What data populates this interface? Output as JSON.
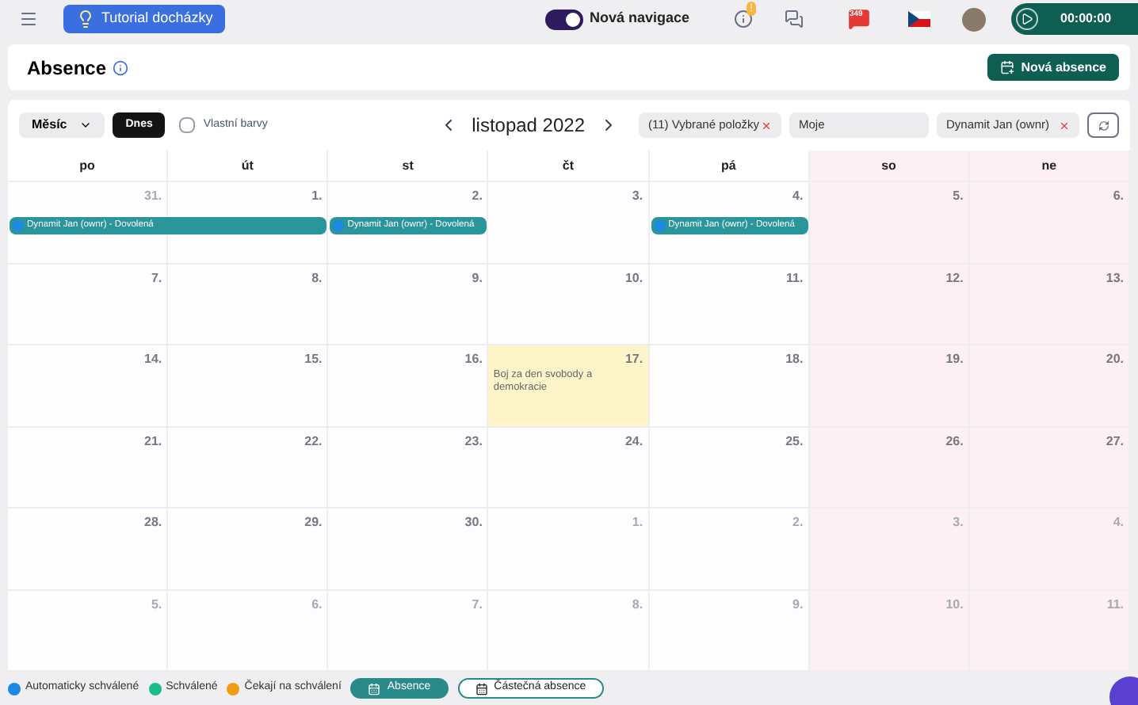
{
  "topbar": {
    "tutorial": "Tutorial docházky",
    "nav_toggle": {
      "label": "Nová navigace",
      "on": true
    },
    "alerts_badge": "!",
    "notifications_badge": "349",
    "timer": "00:00:00"
  },
  "header": {
    "title": "Absence",
    "new_button": "Nová absence"
  },
  "toolbar": {
    "view": "Měsíc",
    "today": "Dnes",
    "custom_colors": {
      "label": "Vlastní barvy",
      "checked": false
    },
    "month": "listopad 2022",
    "filters": [
      {
        "text": "(11) Vybrané položky",
        "clearable": true
      },
      {
        "text": "Moje",
        "clearable": false
      },
      {
        "text": "Dynamit Jan (ownr)",
        "clearable": true
      }
    ]
  },
  "columns": [
    {
      "label": "po",
      "weekend": false
    },
    {
      "label": "út",
      "weekend": false
    },
    {
      "label": "st",
      "weekend": false
    },
    {
      "label": "čt",
      "weekend": false
    },
    {
      "label": "pá",
      "weekend": false
    },
    {
      "label": "so",
      "weekend": true
    },
    {
      "label": "ne",
      "weekend": true
    }
  ],
  "weeks": [
    {
      "days": [
        {
          "label": "31.",
          "other_month": true,
          "event": {
            "text": "Dynamit Jan (ownr) - Dovolená",
            "color": "#1e88e5",
            "extends_to_next": true
          }
        },
        {
          "label": "1.",
          "other_month": false
        },
        {
          "label": "2.",
          "other_month": false,
          "event": {
            "text": "Dynamit Jan (ownr) - Dovolená",
            "color": "#1e88e5",
            "extends_to_next": false
          }
        },
        {
          "label": "3.",
          "other_month": false
        },
        {
          "label": "4.",
          "other_month": false,
          "event": {
            "text": "Dynamit Jan (ownr) - Dovolená",
            "color": "#1e88e5",
            "extends_to_next": false
          }
        },
        {
          "label": "5.",
          "other_month": false
        },
        {
          "label": "6.",
          "other_month": false
        }
      ]
    },
    {
      "days": [
        {
          "label": "7.",
          "other_month": false
        },
        {
          "label": "8.",
          "other_month": false
        },
        {
          "label": "9.",
          "other_month": false
        },
        {
          "label": "10.",
          "other_month": false
        },
        {
          "label": "11.",
          "other_month": false
        },
        {
          "label": "12.",
          "other_month": false
        },
        {
          "label": "13.",
          "other_month": false
        }
      ]
    },
    {
      "days": [
        {
          "label": "14.",
          "other_month": false
        },
        {
          "label": "15.",
          "other_month": false
        },
        {
          "label": "16.",
          "other_month": false
        },
        {
          "label": "17.",
          "other_month": false,
          "holiday": "Boj za den svobody a demokracie"
        },
        {
          "label": "18.",
          "other_month": false
        },
        {
          "label": "19.",
          "other_month": false
        },
        {
          "label": "20.",
          "other_month": false
        }
      ]
    },
    {
      "days": [
        {
          "label": "21.",
          "other_month": false
        },
        {
          "label": "22.",
          "other_month": false
        },
        {
          "label": "23.",
          "other_month": false
        },
        {
          "label": "24.",
          "other_month": false
        },
        {
          "label": "25.",
          "other_month": false
        },
        {
          "label": "26.",
          "other_month": false
        },
        {
          "label": "27.",
          "other_month": false
        }
      ]
    },
    {
      "days": [
        {
          "label": "28.",
          "other_month": false
        },
        {
          "label": "29.",
          "other_month": false
        },
        {
          "label": "30.",
          "other_month": false
        },
        {
          "label": "1.",
          "other_month": true
        },
        {
          "label": "2.",
          "other_month": true
        },
        {
          "label": "3.",
          "other_month": true
        },
        {
          "label": "4.",
          "other_month": true
        }
      ]
    },
    {
      "days": [
        {
          "label": "5.",
          "other_month": true
        },
        {
          "label": "6.",
          "other_month": true
        },
        {
          "label": "7.",
          "other_month": true
        },
        {
          "label": "8.",
          "other_month": true
        },
        {
          "label": "9.",
          "other_month": true
        },
        {
          "label": "10.",
          "other_month": true
        },
        {
          "label": "11.",
          "other_month": true
        }
      ]
    }
  ],
  "legend": [
    {
      "label": "Automaticky schválené",
      "color": "#1e88e5"
    },
    {
      "label": "Schválené",
      "color": "#1abc8c"
    },
    {
      "label": "Čekají na schválení",
      "color": "#f39c12"
    }
  ],
  "bottom_tabs": [
    {
      "label": "Absence",
      "selected": true
    },
    {
      "label": "Částečná absence",
      "selected": false
    }
  ]
}
